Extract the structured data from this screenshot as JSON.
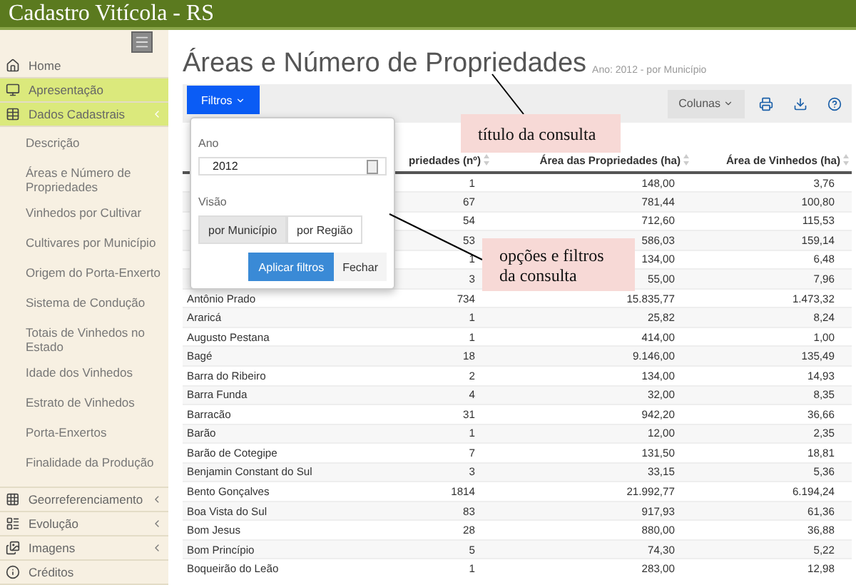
{
  "header": {
    "title": "Cadastro Vitícola - RS"
  },
  "sidebar": {
    "items": [
      {
        "label": "Home",
        "active": false
      },
      {
        "label": "Apresentação",
        "active": true
      },
      {
        "label": "Dados Cadastrais",
        "active": true,
        "expanded": true,
        "children": [
          "Descrição",
          "Áreas e Número de Propriedades",
          "Vinhedos por Cultivar",
          "Cultivares por Município",
          "Origem do Porta-Enxerto",
          "Sistema de Condução",
          "Totais de Vinhedos no Estado",
          "Idade dos Vinhedos",
          "Estrato de Vinhedos",
          "Porta-Enxertos",
          "Finalidade da Produção"
        ]
      },
      {
        "label": "Georreferenciamento",
        "active": false,
        "expanded": false
      },
      {
        "label": "Evolução",
        "active": false,
        "expanded": false
      },
      {
        "label": "Imagens",
        "active": false,
        "expanded": false
      },
      {
        "label": "Créditos",
        "active": false
      }
    ]
  },
  "page": {
    "title": "Áreas e Número de Propriedades",
    "subtitle": "Ano: 2012 - por Município"
  },
  "toolbar": {
    "filter_button": "Filtros",
    "columns_button": "Colunas"
  },
  "filter_panel": {
    "year_label": "Ano",
    "year_value": "2012",
    "view_label": "Visão",
    "view_options": [
      {
        "label": "por Município",
        "selected": true
      },
      {
        "label": "por Região",
        "selected": false
      }
    ],
    "apply_button": "Aplicar filtros",
    "close_button": "Fechar"
  },
  "table": {
    "columns": [
      "priedades (nº)",
      "Área das Propriedades (ha)",
      "Área de Vinhedos (ha)"
    ],
    "rows": [
      {
        "values": [
          "1",
          "148,00",
          "3,76"
        ]
      },
      {
        "values": [
          "67",
          "781,44",
          "100,80"
        ]
      },
      {
        "values": [
          "54",
          "712,60",
          "115,53"
        ]
      },
      {
        "values": [
          "53",
          "586,03",
          "159,14"
        ]
      },
      {
        "values": [
          "1",
          "134,00",
          "6,48"
        ]
      },
      {
        "values": [
          "3",
          "55,00",
          "7,96"
        ]
      },
      {
        "name": "Antônio Prado",
        "values": [
          "734",
          "15.835,77",
          "1.473,32"
        ]
      },
      {
        "name": "Araricá",
        "values": [
          "1",
          "25,82",
          "8,24"
        ]
      },
      {
        "name": "Augusto Pestana",
        "values": [
          "1",
          "414,00",
          "1,00"
        ]
      },
      {
        "name": "Bagé",
        "values": [
          "18",
          "9.146,00",
          "135,49"
        ]
      },
      {
        "name": "Barra do Ribeiro",
        "values": [
          "2",
          "134,00",
          "14,93"
        ]
      },
      {
        "name": "Barra Funda",
        "values": [
          "4",
          "32,00",
          "8,35"
        ]
      },
      {
        "name": "Barracão",
        "values": [
          "31",
          "942,20",
          "36,66"
        ]
      },
      {
        "name": "Barão",
        "values": [
          "1",
          "12,00",
          "2,35"
        ]
      },
      {
        "name": "Barão de Cotegipe",
        "values": [
          "7",
          "131,50",
          "18,81"
        ]
      },
      {
        "name": "Benjamin Constant do Sul",
        "values": [
          "3",
          "33,15",
          "5,36"
        ]
      },
      {
        "name": "Bento Gonçalves",
        "values": [
          "1814",
          "21.992,77",
          "6.194,24"
        ]
      },
      {
        "name": "Boa Vista do Sul",
        "values": [
          "83",
          "917,93",
          "61,36"
        ]
      },
      {
        "name": "Bom Jesus",
        "values": [
          "28",
          "880,00",
          "36,88"
        ]
      },
      {
        "name": "Bom Princípio",
        "values": [
          "5",
          "74,30",
          "5,22"
        ]
      },
      {
        "name": "Boqueirão do Leão",
        "values": [
          "1",
          "283,00",
          "12,98"
        ]
      }
    ]
  },
  "annotations": [
    {
      "text": "título da consulta"
    },
    {
      "text": "opções e filtros da consulta"
    }
  ]
}
